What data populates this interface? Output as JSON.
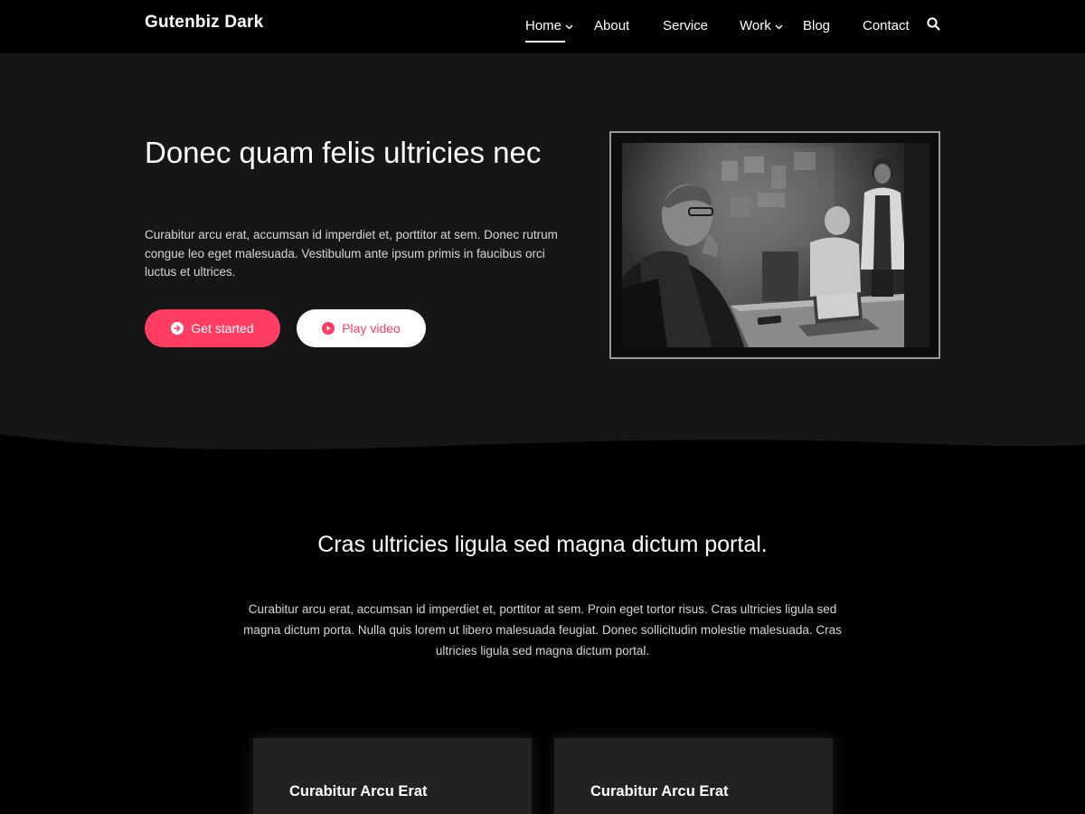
{
  "header": {
    "site_title": "Gutenbiz Dark",
    "nav": [
      {
        "label": "Home",
        "has_dropdown": true,
        "active": true
      },
      {
        "label": "About",
        "has_dropdown": false
      },
      {
        "label": "Service",
        "has_dropdown": false
      },
      {
        "label": "Work",
        "has_dropdown": true
      },
      {
        "label": "Blog",
        "has_dropdown": false
      },
      {
        "label": "Contact",
        "has_dropdown": false
      }
    ],
    "search_icon": "search-icon"
  },
  "hero": {
    "title": "Donec quam felis ultricies nec",
    "text": "Curabitur arcu erat, accumsan id imperdiet et, porttitor at sem. Donec rutrum congue leo eget malesuada. Vestibulum ante ipsum primis in faucibus orci luctus et ultrices.",
    "primary_button": {
      "label": "Get started",
      "icon": "arrow-right-circle-icon"
    },
    "secondary_button": {
      "label": "Play video",
      "icon": "play-circle-icon"
    }
  },
  "intro": {
    "title": "Cras ultricies ligula sed magna dictum portal.",
    "text": "Curabitur arcu erat, accumsan id imperdiet et, porttitor at sem. Proin eget tortor risus. Cras ultricies ligula sed magna dictum porta. Nulla quis lorem ut libero malesuada feugiat. Donec sollicitudin molestie malesuada. Cras ultricies ligula sed magna dictum portal."
  },
  "cards": [
    {
      "title": "Curabitur Arcu Erat"
    },
    {
      "title": "Curabitur Arcu Erat"
    }
  ],
  "colors": {
    "accent": "#ff3d63",
    "hero_bg": "#161616",
    "page_bg": "#000000"
  }
}
